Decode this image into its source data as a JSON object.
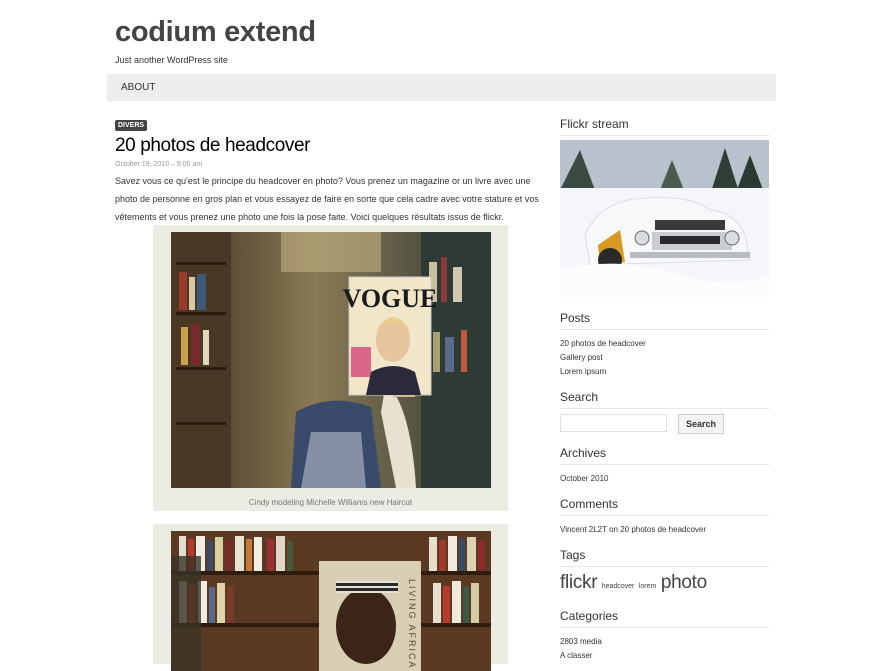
{
  "site": {
    "title": "codium extend",
    "description": "Just another WordPress site"
  },
  "nav": {
    "items": [
      {
        "label": "ABOUT"
      }
    ]
  },
  "post": {
    "category": "DIVERS",
    "title": "20 photos de headcover",
    "date": "October 19, 2010 – 9:00 am",
    "excerpt": "Savez vous ce qu'est le principe du headcover en photo? Vous prenez un magazine or un livre avec une photo de personne en gros plan et vous essayez de faire en sorte que cela cadre avec votre stature et vos vêtements et vous prenez une photo une fois la pose faite. Voici quelques résultats issus de flickr.",
    "images": [
      {
        "caption": "Cindy modeling Michelle Williams new Haircut",
        "magazine": "VOGUE"
      },
      {
        "caption": "",
        "magazine": "LIVING AFRICA"
      }
    ]
  },
  "sidebar": {
    "flickr": {
      "title": "Flickr stream"
    },
    "posts": {
      "title": "Posts",
      "items": [
        "20 photos de headcover",
        "Gallery post",
        "Lorem ipsum"
      ]
    },
    "search": {
      "title": "Search",
      "button_label": "Search",
      "placeholder": ""
    },
    "archives": {
      "title": "Archives",
      "items": [
        "October 2010"
      ]
    },
    "comments": {
      "title": "Comments",
      "items": [
        "Vincent 2L2T on 20 photos de headcover"
      ]
    },
    "tags": {
      "title": "Tags",
      "items": [
        {
          "label": "flickr",
          "size": "large"
        },
        {
          "label": "headcover",
          "size": "small"
        },
        {
          "label": "lorem",
          "size": "small"
        },
        {
          "label": "photo",
          "size": "large"
        }
      ]
    },
    "categories": {
      "title": "Categories",
      "items": [
        "2803 media",
        "A classer"
      ]
    }
  },
  "colors": {
    "nav_background": "#eeeeee",
    "badge_background": "#444444",
    "figure_background": "#ecebe4",
    "text": "#333333"
  }
}
